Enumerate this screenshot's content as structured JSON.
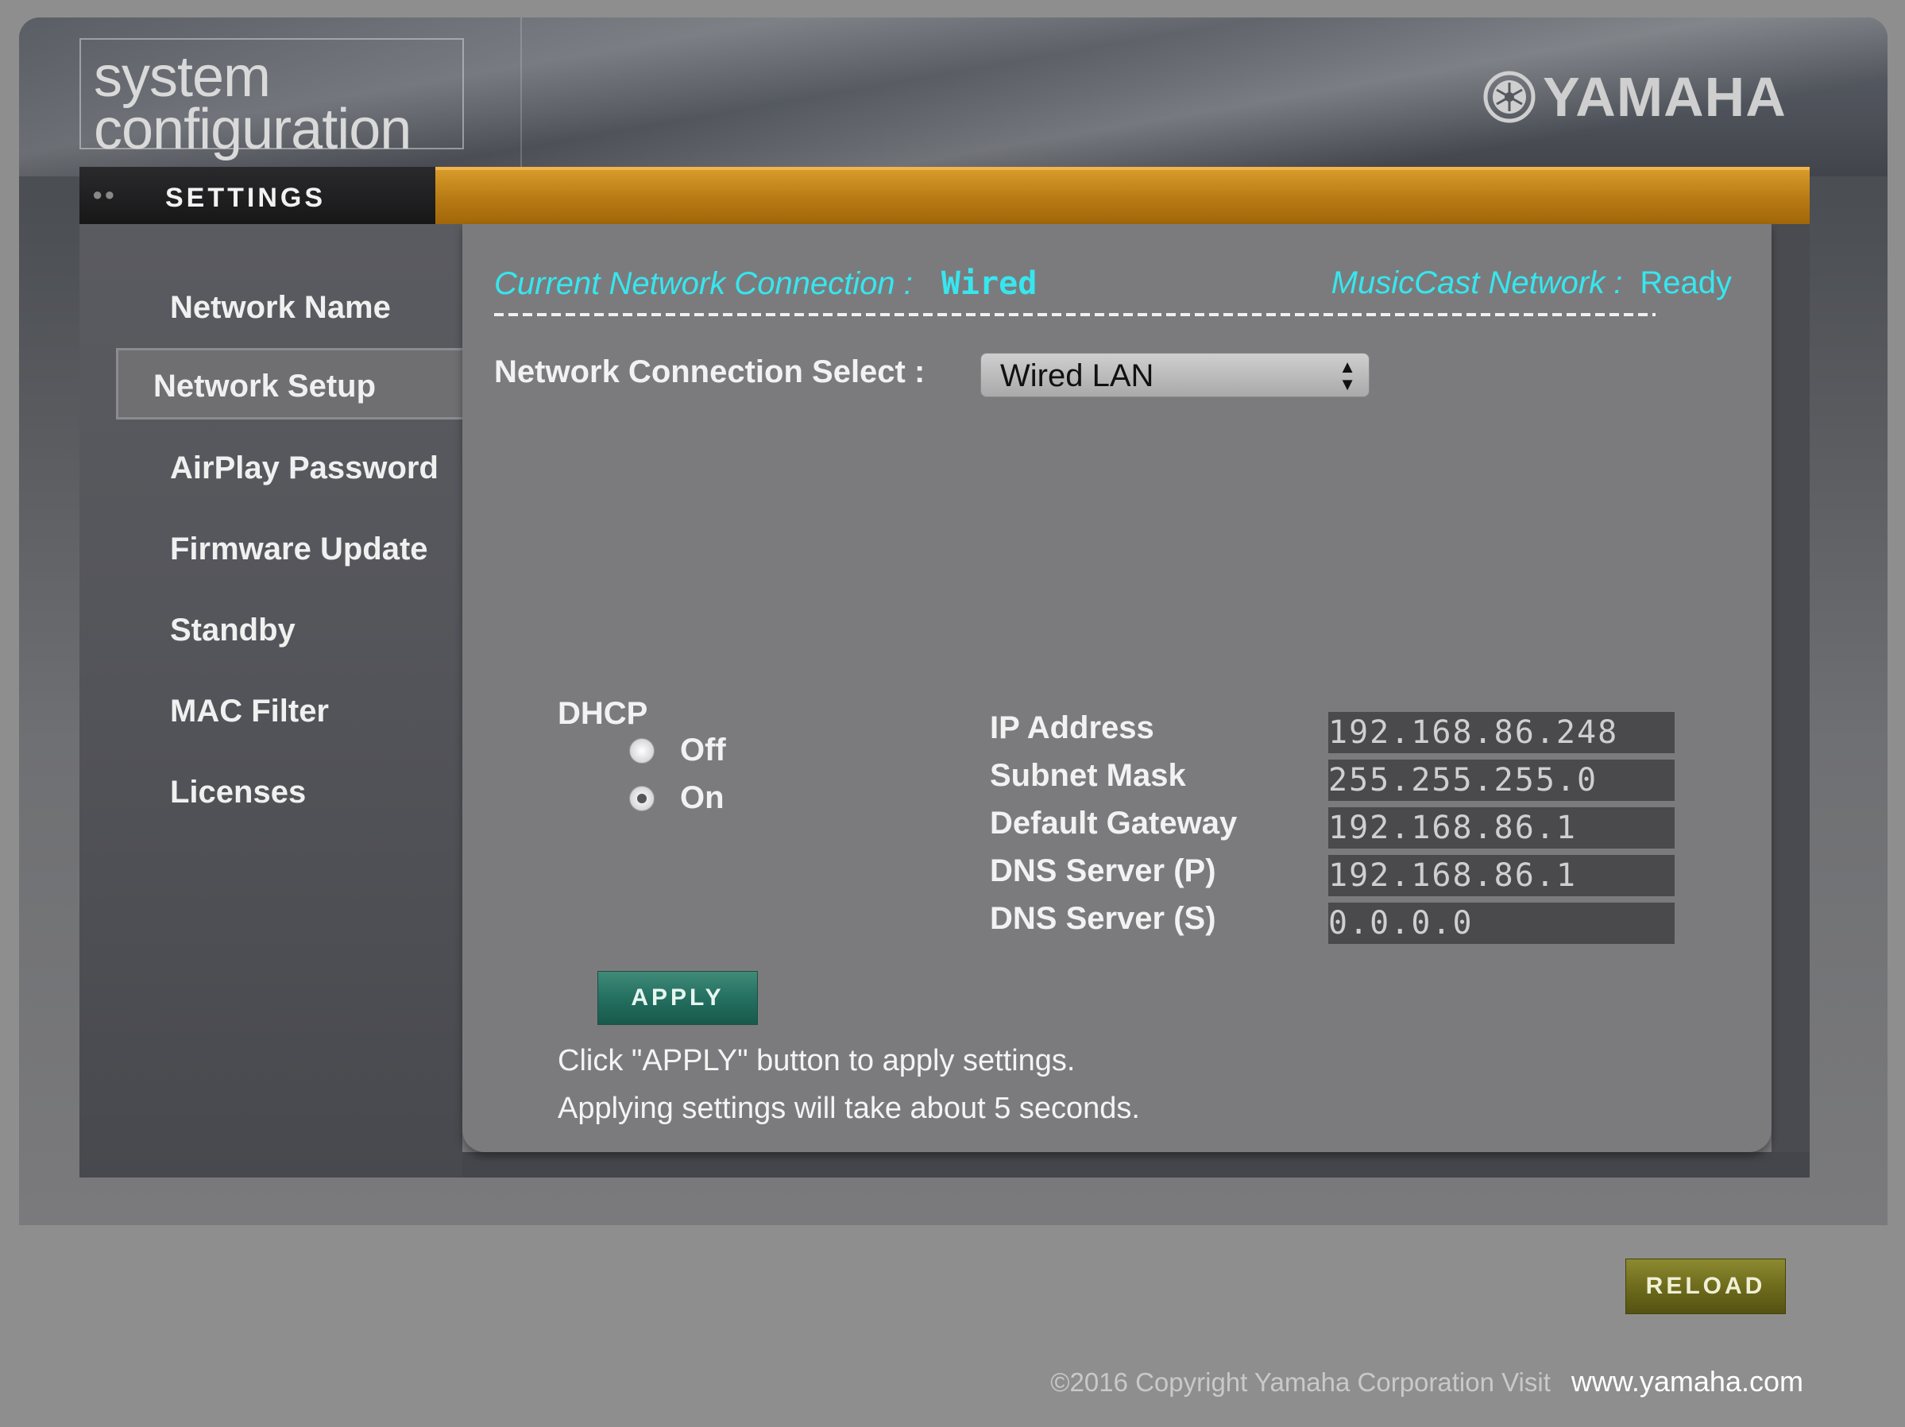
{
  "header": {
    "logo_line1": "system",
    "logo_line2": "configuration",
    "brand": "YAMAHA"
  },
  "settings_tab": {
    "label": "SETTINGS"
  },
  "sidebar": {
    "items": [
      {
        "label": "Network Name"
      },
      {
        "label": "Network Setup",
        "active": true
      },
      {
        "label": "AirPlay Password"
      },
      {
        "label": "Firmware Update"
      },
      {
        "label": "Standby"
      },
      {
        "label": "MAC Filter"
      },
      {
        "label": "Licenses"
      }
    ]
  },
  "status": {
    "connection_label": "Current Network Connection :",
    "connection_value": "Wired",
    "musiccast_label": "MusicCast Network :",
    "musiccast_value": "Ready"
  },
  "network_select": {
    "label": "Network Connection Select :",
    "value": "Wired LAN"
  },
  "dhcp": {
    "title": "DHCP",
    "options": [
      {
        "label": "Off",
        "checked": false
      },
      {
        "label": "On",
        "checked": true
      }
    ]
  },
  "fields": [
    {
      "label": "IP Address",
      "value": "192.168.86.248"
    },
    {
      "label": "Subnet Mask",
      "value": "255.255.255.0"
    },
    {
      "label": "Default Gateway",
      "value": "192.168.86.1"
    },
    {
      "label": "DNS Server (P)",
      "value": "192.168.86.1"
    },
    {
      "label": "DNS Server (S)",
      "value": "0.0.0.0"
    }
  ],
  "apply": {
    "button_label": "APPLY",
    "hint_line1": "Click \"APPLY\" button to apply settings.",
    "hint_line2": "Applying settings will take about 5 seconds."
  },
  "reload": {
    "button_label": "RELOAD"
  },
  "footer": {
    "copyright": "©2016 Copyright Yamaha Corporation Visit",
    "site": "www.yamaha.com"
  },
  "colors": {
    "accent_cyan": "#37e6ee",
    "settings_bar_orange": "#c0821a",
    "apply_green": "#247061",
    "reload_olive": "#6e6c1c"
  }
}
